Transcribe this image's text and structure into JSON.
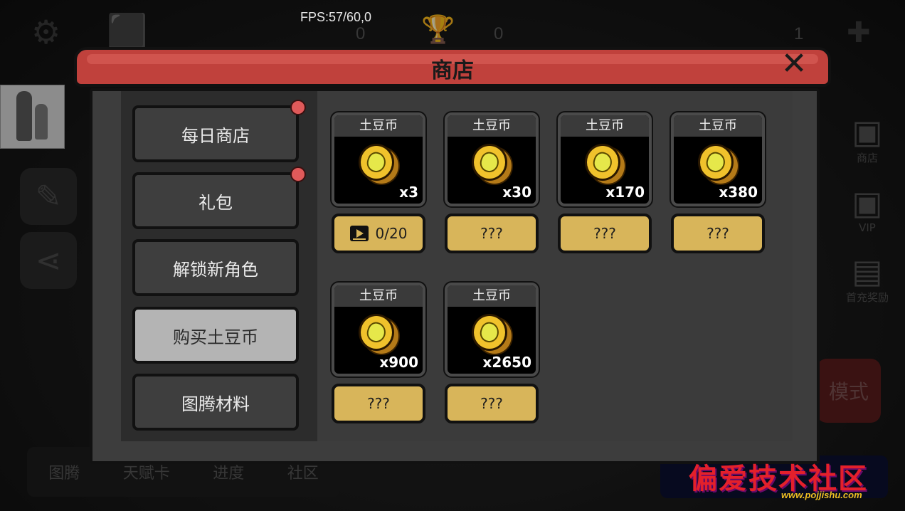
{
  "hud": {
    "fps": "FPS:57/60,0",
    "counter_a": "0",
    "counter_b": "0",
    "coin_count": "1",
    "add_icon": "plus-icon",
    "settings_icon": "gear-icon"
  },
  "background": {
    "right_menu": [
      "商店",
      "VIP",
      "首充奖励"
    ],
    "bottom_tabs": [
      "图腾",
      "天赋卡",
      "进度",
      "社区"
    ],
    "mode_label": "模式"
  },
  "dialog": {
    "title": "商店",
    "close_icon": "close-icon"
  },
  "sidebar": {
    "items": [
      {
        "label": "每日商店",
        "badge": true
      },
      {
        "label": "礼包",
        "badge": true
      },
      {
        "label": "解锁新角色",
        "badge": false
      },
      {
        "label": "购买土豆币",
        "badge": false,
        "active": true
      },
      {
        "label": "图腾材料",
        "badge": false
      }
    ]
  },
  "products": [
    {
      "name": "土豆币",
      "quantity": "x3",
      "price": "0/20",
      "price_icon": "video-ad-icon"
    },
    {
      "name": "土豆币",
      "quantity": "x30",
      "price": "???"
    },
    {
      "name": "土豆币",
      "quantity": "x170",
      "price": "???"
    },
    {
      "name": "土豆币",
      "quantity": "x380",
      "price": "???"
    },
    {
      "name": "土豆币",
      "quantity": "x900",
      "price": "???"
    },
    {
      "name": "土豆币",
      "quantity": "x2650",
      "price": "???"
    }
  ],
  "watermark": {
    "text": "偏爱技术社区",
    "url": "www.pojjishu.com"
  },
  "colors": {
    "ribbon": "#c0413c",
    "price_button": "#d8b55a",
    "active_tab": "#b4b4b4",
    "badge": "#e05a5a"
  }
}
